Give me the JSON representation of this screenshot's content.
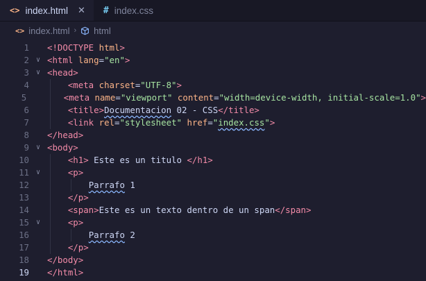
{
  "tabs": [
    {
      "name": "index.html",
      "icon": "html-file-icon",
      "active": true,
      "close": "✕"
    },
    {
      "name": "index.css",
      "icon": "css-file-icon",
      "active": false
    }
  ],
  "breadcrumb": {
    "file": "index.html",
    "symbol": "html"
  },
  "lines": [
    {
      "n": "1",
      "fold": "",
      "indent": "",
      "parts": [
        [
          "t",
          "<!DOCTYPE "
        ],
        [
          "a",
          "html"
        ],
        [
          "t",
          ">"
        ]
      ]
    },
    {
      "n": "2",
      "fold": "∨",
      "indent": "",
      "parts": [
        [
          "t",
          "<html "
        ],
        [
          "a",
          "lang"
        ],
        [
          "x",
          "="
        ],
        [
          "s",
          "\"en\""
        ],
        [
          "t",
          ">"
        ]
      ]
    },
    {
      "n": "3",
      "fold": "∨",
      "indent": "",
      "parts": [
        [
          "t",
          "<head>"
        ]
      ]
    },
    {
      "n": "4",
      "fold": "",
      "indent": "    ",
      "parts": [
        [
          "t",
          "<meta "
        ],
        [
          "a",
          "charset"
        ],
        [
          "x",
          "="
        ],
        [
          "s",
          "\"UTF-8\""
        ],
        [
          "t",
          ">"
        ]
      ]
    },
    {
      "n": "5",
      "fold": "",
      "indent": "    ",
      "parts": [
        [
          "t",
          "<meta "
        ],
        [
          "a",
          "name"
        ],
        [
          "x",
          "="
        ],
        [
          "s",
          "\"viewport\""
        ],
        [
          "x",
          " "
        ],
        [
          "a",
          "content"
        ],
        [
          "x",
          "="
        ],
        [
          "s",
          "\"width=device-width, initial-scale=1.0\""
        ],
        [
          "t",
          ">"
        ]
      ]
    },
    {
      "n": "6",
      "fold": "",
      "indent": "    ",
      "parts": [
        [
          "t",
          "<title>"
        ],
        [
          "xq",
          "Documentacion"
        ],
        [
          "x",
          " 02 - CSS"
        ],
        [
          "t",
          "</title>"
        ]
      ]
    },
    {
      "n": "7",
      "fold": "",
      "indent": "    ",
      "parts": [
        [
          "t",
          "<link "
        ],
        [
          "a",
          "rel"
        ],
        [
          "x",
          "="
        ],
        [
          "s",
          "\"stylesheet\""
        ],
        [
          "x",
          " "
        ],
        [
          "a",
          "href"
        ],
        [
          "x",
          "="
        ],
        [
          "s",
          "\""
        ],
        [
          "sq",
          "index.css"
        ],
        [
          "s",
          "\""
        ],
        [
          "t",
          ">"
        ]
      ]
    },
    {
      "n": "8",
      "fold": "",
      "indent": "",
      "parts": [
        [
          "t",
          "</head>"
        ]
      ]
    },
    {
      "n": "9",
      "fold": "∨",
      "indent": "",
      "parts": [
        [
          "t",
          "<body>"
        ]
      ]
    },
    {
      "n": "10",
      "fold": "",
      "indent": "    ",
      "parts": [
        [
          "t",
          "<h1>"
        ],
        [
          "x",
          " Este es un titulo "
        ],
        [
          "t",
          "</h1>"
        ]
      ]
    },
    {
      "n": "11",
      "fold": "∨",
      "indent": "    ",
      "parts": [
        [
          "t",
          "<p>"
        ]
      ]
    },
    {
      "n": "12",
      "fold": "",
      "indent": "        ",
      "parts": [
        [
          "xq",
          "Parrafo"
        ],
        [
          "x",
          " 1"
        ]
      ]
    },
    {
      "n": "13",
      "fold": "",
      "indent": "    ",
      "parts": [
        [
          "t",
          "</p>"
        ]
      ]
    },
    {
      "n": "14",
      "fold": "",
      "indent": "    ",
      "parts": [
        [
          "t",
          "<span>"
        ],
        [
          "x",
          "Este es un texto dentro de un span"
        ],
        [
          "t",
          "</span>"
        ]
      ]
    },
    {
      "n": "15",
      "fold": "∨",
      "indent": "    ",
      "parts": [
        [
          "t",
          "<p>"
        ]
      ]
    },
    {
      "n": "16",
      "fold": "",
      "indent": "        ",
      "parts": [
        [
          "xq",
          "Parrafo"
        ],
        [
          "x",
          " 2"
        ]
      ]
    },
    {
      "n": "17",
      "fold": "",
      "indent": "    ",
      "parts": [
        [
          "t",
          "</p>"
        ]
      ]
    },
    {
      "n": "18",
      "fold": "",
      "indent": "",
      "parts": [
        [
          "t",
          "</body>"
        ]
      ]
    },
    {
      "n": "19",
      "fold": "",
      "indent": "",
      "parts": [
        [
          "t",
          "</html>"
        ]
      ]
    }
  ],
  "current_line": "19"
}
